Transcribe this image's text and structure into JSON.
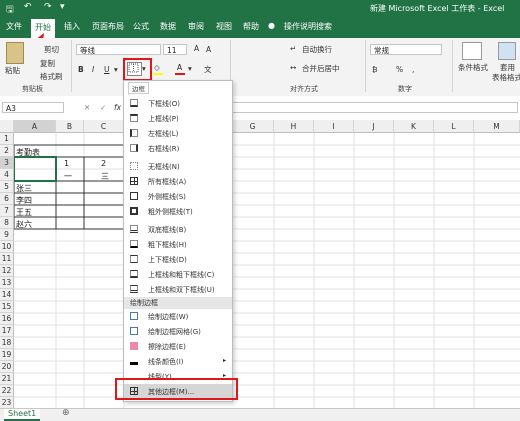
{
  "titlebar": {
    "title": "新建 Microsoft Excel 工作表 - Excel",
    "search": "操作说明搜索"
  },
  "tabs": [
    "文件",
    "开始",
    "插入",
    "页面布局",
    "公式",
    "数据",
    "审阅",
    "视图",
    "帮助"
  ],
  "ribbon": {
    "clipboard": {
      "paste": "粘贴",
      "cut": "剪切",
      "copy": "复制",
      "format_painter": "格式刷",
      "group": "剪贴板"
    },
    "font": {
      "name": "等线",
      "size": "11",
      "bold": "B",
      "italic": "I",
      "underline": "U"
    },
    "alignment": {
      "wrap": "自动换行",
      "merge": "合并后居中",
      "group": "对齐方式"
    },
    "number": {
      "format": "常规",
      "group": "数字",
      "percent": "%",
      "comma": ","
    },
    "styles": {
      "cond_format": "条件格式",
      "table_format_1": "套用",
      "table_format_2": "表格格式"
    }
  },
  "formula_bar": {
    "name_box": "A3",
    "fx": "fx"
  },
  "columns": [
    "A",
    "B",
    "C",
    "D",
    "E",
    "F",
    "G",
    "H",
    "I",
    "J",
    "K",
    "L",
    "M"
  ],
  "rows": [
    "1",
    "2",
    "3",
    "4",
    "5",
    "6",
    "7",
    "8",
    "9",
    "10",
    "11",
    "12",
    "13",
    "14",
    "15",
    "16",
    "17",
    "18",
    "19",
    "20",
    "21",
    "22",
    "23"
  ],
  "cells": {
    "a2": "考勤表",
    "b3": "1",
    "c3": "2",
    "b4": "一",
    "c4": "三",
    "a5": "张三",
    "a6": "李四",
    "a7": "王五",
    "a8": "赵六"
  },
  "border_menu": {
    "tooltip": "边框",
    "items": [
      "下框线(O)",
      "上框线(P)",
      "左框线(L)",
      "右框线(R)",
      "无框线(N)",
      "所有框线(A)",
      "外侧框线(S)",
      "粗外侧框线(T)",
      "双底框线(B)",
      "粗下框线(H)",
      "上下框线(D)",
      "上框线和粗下框线(C)",
      "上框线和双下框线(U)"
    ],
    "draw_header": "绘制边框",
    "draw_items": [
      "绘制边框(W)",
      "绘制边框网格(G)",
      "擦除边框(E)",
      "线条颜色(I)",
      "线型(Y)",
      "其他边框(M)..."
    ]
  },
  "sheet_tab": "Sheet1",
  "colors": {
    "excel_green": "#217346",
    "highlight_red": "#e0161b",
    "font_red": "#e0161b"
  }
}
